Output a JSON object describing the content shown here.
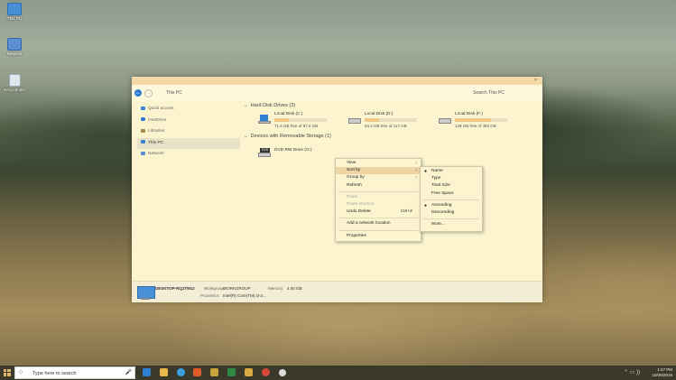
{
  "desktop": {
    "icons": [
      {
        "label": "This PC"
      },
      {
        "label": "Network"
      },
      {
        "label": "Recycle Bin"
      }
    ]
  },
  "window": {
    "close_glyph": "×",
    "address": {
      "back_glyph": "←",
      "forward_glyph": "→",
      "path": "This PC",
      "search_placeholder": "Search This PC"
    },
    "sidebar": {
      "items": [
        {
          "label": "Quick access",
          "icon": "star-icon",
          "color": "#3b82d6"
        },
        {
          "label": "OneDrive",
          "icon": "cloud-icon",
          "color": "#2a6fd6"
        },
        {
          "label": "Libraries",
          "icon": "library-icon",
          "color": "#a48a4a"
        },
        {
          "label": "This PC",
          "icon": "computer-icon",
          "color": "#3b82d6",
          "selected": true
        },
        {
          "label": "Network",
          "icon": "network-icon",
          "color": "#5a8fd6"
        }
      ]
    },
    "sections": {
      "hdd_title": "Hard Disk Drives (3)",
      "removable_title": "Devices with Removable Storage (1)"
    },
    "drives": [
      {
        "name": "Local Disk (C:)",
        "free": "71.6 GB free of 97.6 GB",
        "used_fraction": 0.27
      },
      {
        "name": "Local Disk (D:)",
        "free": "84.2 GB free of 117 GB",
        "used_fraction": 0.28
      },
      {
        "name": "Local Disk (F:)",
        "free": "149 GB free of 483 GB",
        "used_fraction": 0.69
      }
    ],
    "dvd": {
      "name": "DVD RW Drive (G:)",
      "badge": "DVD"
    },
    "details": {
      "computer_name": "DESKTOP-RQJT9G2",
      "workgroup_label": "Workgroup:",
      "workgroup_value": "WORKGROUP",
      "memory_label": "Memory:",
      "memory_value": "4.00 GB",
      "processor_label": "Processor:",
      "processor_value": "Intel(R) Core(TM) i3-2..."
    }
  },
  "context_menu": {
    "items": [
      {
        "label": "View",
        "submenu": true
      },
      {
        "label": "Sort by",
        "submenu": true,
        "hover": true
      },
      {
        "label": "Group by",
        "submenu": true
      },
      {
        "label": "Refresh"
      },
      {
        "label": "Paste",
        "disabled": true
      },
      {
        "label": "Paste shortcut",
        "disabled": true
      },
      {
        "label": "Undo Delete",
        "shortcut": "Ctrl+Z"
      },
      {
        "label": "Add a network location"
      },
      {
        "label": "Properties"
      }
    ],
    "arrow_glyph": "›"
  },
  "sort_menu": {
    "bullet_glyph": "●",
    "items": [
      {
        "label": "Name",
        "checked": true
      },
      {
        "label": "Type"
      },
      {
        "label": "Total Size"
      },
      {
        "label": "Free Space"
      },
      {
        "label": "Ascending",
        "checked": true
      },
      {
        "label": "Descending"
      },
      {
        "label": "More..."
      }
    ]
  },
  "taskbar": {
    "search_placeholder": "Type here to search",
    "search_glyph": "○",
    "mic_glyph": "🎤",
    "apps": [
      {
        "name": "edge",
        "color": "#2d7fd3"
      },
      {
        "name": "file-explorer",
        "color": "#e8b64a"
      },
      {
        "name": "telegram",
        "color": "#3aa0e0"
      },
      {
        "name": "brave",
        "color": "#e05a2a"
      },
      {
        "name": "maps",
        "color": "#c9a63c"
      },
      {
        "name": "excel",
        "color": "#2f8a46"
      },
      {
        "name": "folder",
        "color": "#d8a940"
      },
      {
        "name": "chrome",
        "color": "#d9473b"
      },
      {
        "name": "settings",
        "color": "#dddddd"
      }
    ],
    "tray_icons": "⌃ ▭ ))",
    "time": "1:47 PM",
    "date": "10/26/2018"
  }
}
